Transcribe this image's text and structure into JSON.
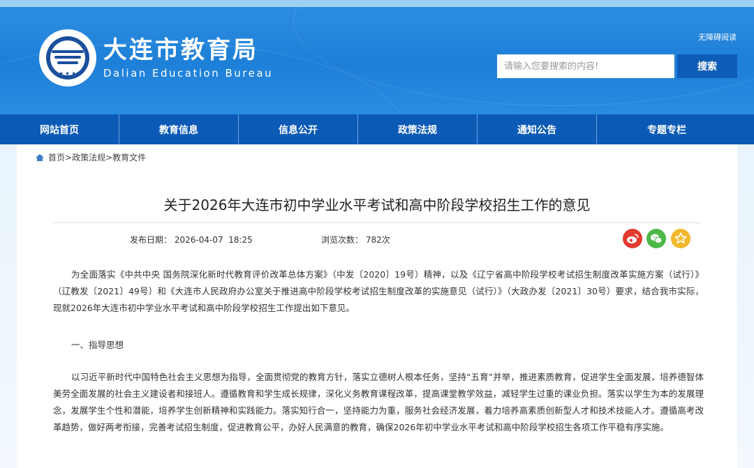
{
  "header": {
    "title": "大连市教育局",
    "subtitle": "Dalian Education Bureau",
    "accessible_label": "无障碍阅读",
    "search": {
      "placeholder": "请输入您要搜索的内容!",
      "button_label": "搜索"
    },
    "colors": {
      "banner": "#1e7fd8",
      "nav": "#0b5ab5",
      "search_button": "#0d5cb6"
    }
  },
  "nav": {
    "items": [
      {
        "label": "网站首页"
      },
      {
        "label": "教育信息"
      },
      {
        "label": "信息公开"
      },
      {
        "label": "政策法规"
      },
      {
        "label": "通知公告"
      },
      {
        "label": "专题专栏"
      }
    ]
  },
  "breadcrumb": {
    "icon": "home-icon",
    "items": [
      "首页",
      "政策法规",
      "教育文件"
    ],
    "separator": ">"
  },
  "article": {
    "title": "关于2026年大连市初中学业水平考试和高中阶段学校招生工作的意见",
    "date_label": "发布日期：",
    "date_value": "2026-04-07  18:25",
    "views_label": "浏览次数：",
    "views_value": "782次",
    "share_icons": [
      "weibo-icon",
      "wechat-icon",
      "favorite-star-icon"
    ],
    "paragraphs": [
      "为全面落实《中共中央 国务院深化新时代教育评价改革总体方案》（中发〔2020〕19号）精神，以及《辽宁省高中阶段学校考试招生制度改革实施方案（试行）》（辽教发〔2021〕49号）和《大连市人民政府办公室关于推进高中阶段学校考试招生制度改革的实施意见（试行）》（大政办发〔2021〕30号）要求，结合我市实际，现就2026年大连市初中学业水平考试和高中阶段学校招生工作提出如下意见。",
      "以习近平新时代中国特色社会主义思想为指导，全面贯彻党的教育方针，落实立德树人根本任务，坚持“五育”并举，推进素质教育，促进学生全面发展，培养德智体美劳全面发展的社会主义建设者和接班人。遵循教育和学生成长规律，深化义务教育课程改革，提高课堂教学效益，减轻学生过重的课业负担。落实以学生为本的发展理念，发展学生个性和潜能，培养学生创新精神和实践能力。落实知行合一，坚持能力为重，服务社会经济发展，着力培养高素质创新型人才和技术技能人才。遵循高考改革趋势，做好两考衔接，完善考试招生制度，促进教育公平，办好人民满意的教育，确保2026年初中学业水平考试和高中阶段学校招生各项工作平稳有序实施。"
    ],
    "section_1": "一、指导思想"
  }
}
